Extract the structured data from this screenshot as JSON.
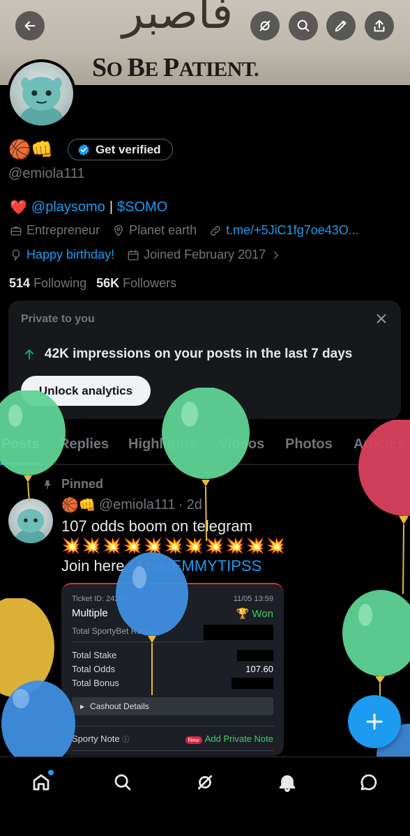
{
  "banner": {
    "arabic_text": "فاصبر",
    "caption_big1": "S",
    "caption_small1": "O ",
    "caption_big2": "B",
    "caption_small2": "E ",
    "caption_big3": "P",
    "caption_small3": "ATIENT."
  },
  "header": {
    "back_icon": "arrow-left-icon",
    "grok_icon": "grok-icon",
    "search_icon": "search-icon",
    "edit_icon": "pencil-icon",
    "share_icon": "share-icon"
  },
  "profile": {
    "emojis": "🏀👊",
    "verify_label": "Get verified",
    "handle": "@emiola111",
    "bio_heart": "❤️",
    "bio_mention": "@playsomo",
    "bio_sep": "|",
    "bio_cashtag": "$SOMO",
    "profession": "Entrepreneur",
    "location": "Planet earth",
    "website": "t.me/+5JiC1fg7oe43O...",
    "birthday": "Happy birthday!",
    "joined": "Joined February 2017",
    "following_count": "514",
    "following_label": "Following",
    "followers_count": "56K",
    "followers_label": "Followers"
  },
  "private_card": {
    "title": "Private to you",
    "impressions_text": "42K impressions on your posts in the last 7 days",
    "unlock_label": "Unlock analytics"
  },
  "tabs": [
    "Posts",
    "Replies",
    "Highlights",
    "Videos",
    "Photos",
    "Articles"
  ],
  "post": {
    "pinned_label": "Pinned",
    "author_emojis": "🏀👊",
    "author_handle": "@emiola111",
    "time": "· 2d",
    "line1": "107 odds boom on telegram",
    "sparkles": "💥💥💥💥💥💥💥💥💥💥💥",
    "line3_prefix": "Join here : ",
    "line3_link": "t.me/EMMYTIPSS"
  },
  "ticket": {
    "ticket_id": "Ticket ID: 242671",
    "datetime": "11/05 13:59",
    "type": "Multiple",
    "status": "Won",
    "total_return_label": "Total SportyBet Return",
    "total_stake_label": "Total Stake",
    "total_odds_label": "Total Odds",
    "total_odds_value": "107.60",
    "total_bonus_label": "Total Bonus",
    "cashout_label": "Cashout Details",
    "note_label": "Sporty Note",
    "new_badge": "New",
    "add_note_label": "Add Private Note"
  },
  "fab": {
    "icon": "plus-icon"
  },
  "nav": [
    "home-icon",
    "search-icon",
    "grok-icon",
    "notifications-icon",
    "messages-icon"
  ],
  "colors": {
    "accent": "#1d9bf0",
    "green": "#00ba7c",
    "balloon_green": "#5fd394",
    "balloon_blue": "#3f8fe0",
    "balloon_red": "#d9415e",
    "balloon_yellow": "#e7b93a"
  }
}
